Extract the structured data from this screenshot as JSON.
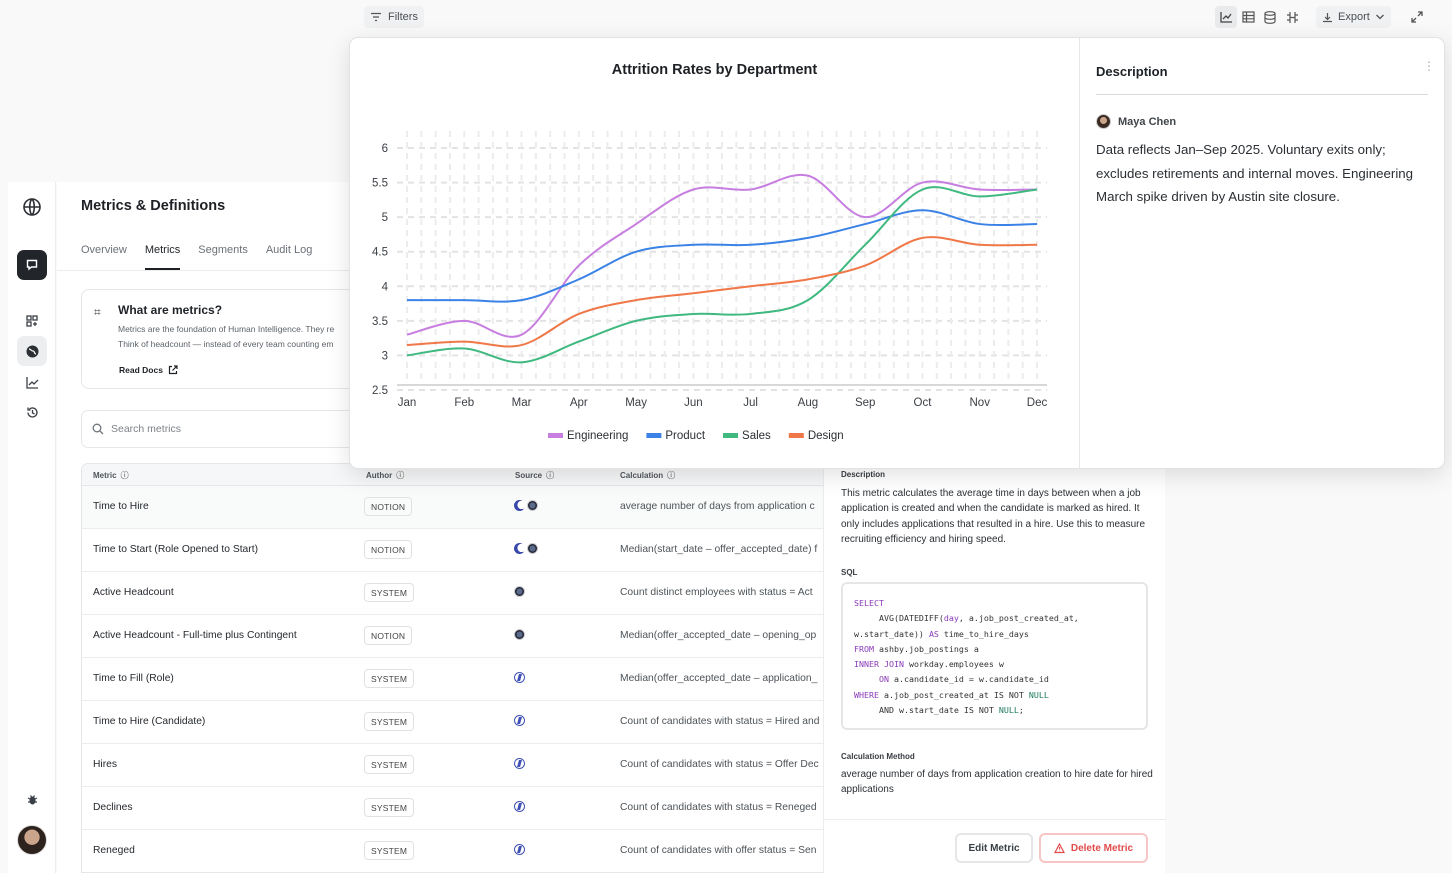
{
  "toolbar": {
    "filters_label": "Filters",
    "export_label": "Export"
  },
  "page": {
    "title": "Metrics & Definitions",
    "tabs": [
      {
        "label": "Overview"
      },
      {
        "label": "Metrics",
        "active": true
      },
      {
        "label": "Segments"
      },
      {
        "label": "Audit Log"
      }
    ]
  },
  "info_card": {
    "title": "What are metrics?",
    "line1": "Metrics are the foundation of Human Intelligence. They re",
    "line2": "Think of headcount — instead of every team counting em",
    "link": "Read Docs"
  },
  "search": {
    "placeholder": "Search metrics"
  },
  "table": {
    "headers": {
      "metric": "Metric",
      "author": "Author",
      "source": "Source",
      "calculation": "Calculation"
    },
    "rows": [
      {
        "name": "Time to Hire",
        "author": "NOTION",
        "sources": [
          "moon",
          "globe"
        ],
        "calc": "average number of days from application c"
      },
      {
        "name": "Time to Start (Role Opened to Start)",
        "author": "NOTION",
        "sources": [
          "moon",
          "globe"
        ],
        "calc": "Median(start_date – offer_accepted_date) f"
      },
      {
        "name": "Active Headcount",
        "author": "SYSTEM",
        "sources": [
          "globe"
        ],
        "calc": "Count distinct employees with status = Act"
      },
      {
        "name": "Active Headcount - Full-time plus Contingent",
        "author": "NOTION",
        "sources": [
          "globe"
        ],
        "calc": "Median(offer_accepted_date – opening_op"
      },
      {
        "name": "Time to Fill (Role)",
        "author": "SYSTEM",
        "sources": [
          "nt"
        ],
        "calc": "Median(offer_accepted_date – application_"
      },
      {
        "name": "Time to Hire (Candidate)",
        "author": "SYSTEM",
        "sources": [
          "nt"
        ],
        "calc": "Count of candidates with status = Hired and"
      },
      {
        "name": "Hires",
        "author": "SYSTEM",
        "sources": [
          "nt"
        ],
        "calc": "Count of candidates with status = Offer Dec"
      },
      {
        "name": "Declines",
        "author": "SYSTEM",
        "sources": [
          "nt"
        ],
        "calc": "Count of candidates with status = Reneged"
      },
      {
        "name": "Reneged",
        "author": "SYSTEM",
        "sources": [
          "nt"
        ],
        "calc": "Count of candidates with offer status = Sen"
      }
    ]
  },
  "detail": {
    "description_label": "Description",
    "description": "This metric calculates the average time in days between when a job application is created and when the candidate is marked as hired. It only includes applications that resulted in a hire. Use this to measure recruiting efficiency and hiring speed.",
    "sql_label": "SQL",
    "calc_method_label": "Calculation Method",
    "calc_method": "average number of days from application creation to hire date for hired applications",
    "edit_label": "Edit Metric",
    "delete_label": "Delete Metric"
  },
  "overlay": {
    "description_heading": "Description",
    "author": "Maya Chen",
    "body": "Data reflects Jan–Sep 2025. Voluntary exits only; excludes retirements and internal moves. Engineering March spike driven by Austin site closure."
  },
  "chart_data": {
    "type": "line",
    "title": "Attrition Rates by Department",
    "xlabel": "",
    "ylabel": "",
    "x": [
      "Jan",
      "Feb",
      "Mar",
      "Apr",
      "May",
      "Jun",
      "Jul",
      "Aug",
      "Sep",
      "Oct",
      "Nov",
      "Dec"
    ],
    "ylim": [
      2.5,
      6
    ],
    "yticks": [
      2.5,
      3,
      3.5,
      4,
      4.5,
      5,
      5.5,
      6
    ],
    "grid": true,
    "legend_position": "bottom",
    "series": [
      {
        "name": "Engineering",
        "color": "#c77ee0",
        "values": [
          3.3,
          3.5,
          3.3,
          4.3,
          4.9,
          5.4,
          5.4,
          5.6,
          5.0,
          5.5,
          5.4,
          5.4
        ]
      },
      {
        "name": "Product",
        "color": "#3b82e6",
        "values": [
          3.8,
          3.8,
          3.8,
          4.1,
          4.5,
          4.6,
          4.6,
          4.7,
          4.9,
          5.1,
          4.9,
          4.9
        ]
      },
      {
        "name": "Sales",
        "color": "#3fb97f",
        "values": [
          3.0,
          3.1,
          2.9,
          3.2,
          3.5,
          3.6,
          3.6,
          3.8,
          4.6,
          5.4,
          5.3,
          5.4
        ]
      },
      {
        "name": "Design",
        "color": "#f07748",
        "values": [
          3.15,
          3.2,
          3.15,
          3.6,
          3.8,
          3.9,
          4.0,
          4.1,
          4.3,
          4.7,
          4.6,
          4.6
        ]
      }
    ]
  }
}
